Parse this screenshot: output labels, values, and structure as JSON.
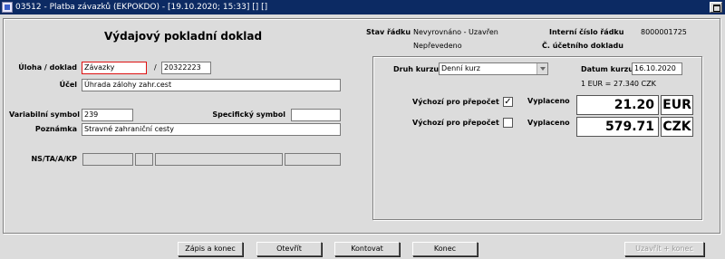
{
  "window": {
    "title": "03512 - Platba závazků (EKPOKDO) - [19.10.2020; 15:33] [] []"
  },
  "form": {
    "heading": "Výdajový pokladní doklad",
    "uloha_label": "Úloha / doklad",
    "uloha_value": "Závazky",
    "separator": "/",
    "doklad_value": "20322223",
    "ucel_label": "Účel",
    "ucel_value": "Úhrada zálohy zahr.cest",
    "var_symbol_label": "Variabilní symbol",
    "var_symbol_value": "239",
    "spec_symbol_label": "Specifický symbol",
    "spec_symbol_value": "",
    "poznamka_label": "Poznámka",
    "poznamka_value": "Stravné zahraniční cesty",
    "ns_label": "NS/TA/A/KP"
  },
  "status": {
    "stav_label": "Stav řádku",
    "stav_value1": "Nevyrovnáno - Uzavřen",
    "stav_value2": "Nepřevedeno",
    "interni_label": "Interní číslo řádku",
    "interni_value": "8000001725",
    "ucetni_label": "Č. účetního dokladu"
  },
  "currency": {
    "druh_label": "Druh kurzu",
    "druh_value": "Denní kurz",
    "datum_label": "Datum kurzu",
    "datum_value": "16.10.2020",
    "rate_left": "1 EUR =",
    "rate_right": "27.340 CZK",
    "vychozi_label_1": "Výchozí pro přepočet",
    "vychozi_check_1": "✓",
    "vychozi_label_2": "Výchozí pro přepočet",
    "vyplaceno_label_1": "Vyplaceno",
    "vyplaceno_value_1": "21.20",
    "currency_1": "EUR",
    "vyplaceno_label_2": "Vyplaceno",
    "vyplaceno_value_2": "579.71",
    "currency_2": "CZK"
  },
  "buttons": {
    "zapis": "Zápis a konec",
    "otevrit": "Otevřít",
    "kontovat": "Kontovat",
    "konec": "Konec",
    "uzavrit": "Uzavřít + konec"
  }
}
